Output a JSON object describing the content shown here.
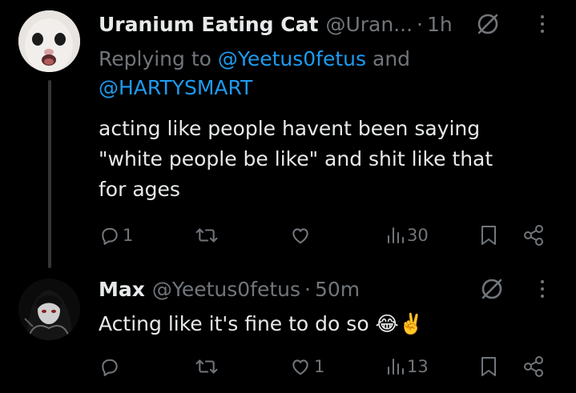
{
  "tweets": [
    {
      "author_name": "Uranium Eating Cat",
      "handle": "@Uran...",
      "separator": "·",
      "time": "1h",
      "replying_prefix": "Replying to ",
      "replying_mention_1": "@Yeetus0fetus",
      "replying_and": " and",
      "replying_mention_2": "@HARTYSMART",
      "text": "acting like people havent been saying\n\"white people be like\" and shit like that\nfor ages",
      "reply_count": "1",
      "retweet_count": "",
      "like_count": "",
      "view_count": "30"
    },
    {
      "author_name": "Max",
      "handle": "@Yeetus0fetus",
      "separator": "·",
      "time": "50m",
      "text": "Acting like it's fine to do so 😂✌️",
      "reply_count": "",
      "retweet_count": "",
      "like_count": "1",
      "view_count": "13"
    }
  ],
  "icons": {
    "reply": "reply-icon",
    "retweet": "retweet-icon",
    "like": "heart-icon",
    "views": "views-icon",
    "bookmark": "bookmark-icon",
    "share": "share-icon",
    "grok": "grok-icon",
    "more": "more-icon"
  },
  "colors": {
    "background": "#000000",
    "text": "#e7e9ea",
    "muted": "#71767b",
    "link": "#1d9bf0",
    "thread_line": "#333639"
  }
}
